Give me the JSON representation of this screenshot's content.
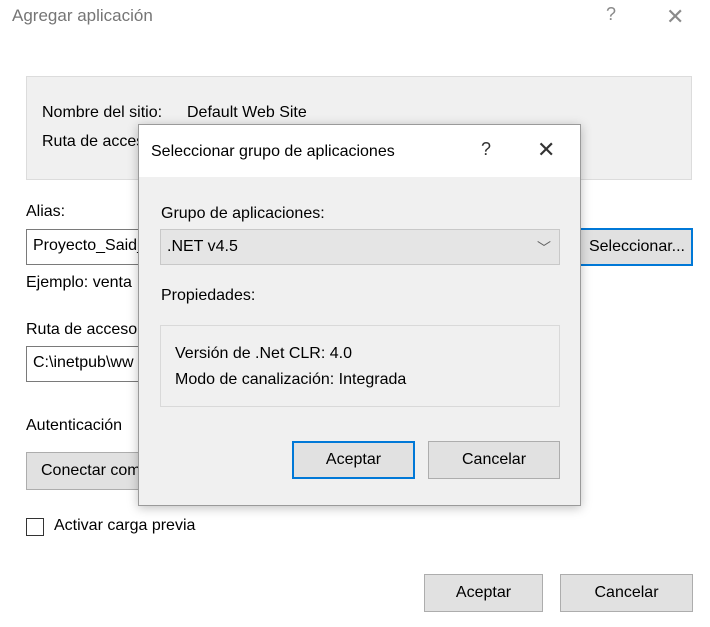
{
  "window": {
    "title": "Agregar aplicación",
    "help_glyph": "?",
    "close_glyph": "✕"
  },
  "site": {
    "name_label": "Nombre del sitio:",
    "name_value": "Default Web Site",
    "path_label": "Ruta de acces"
  },
  "alias": {
    "label": "Alias:",
    "value": "Proyecto_Said_",
    "select_button": "Seleccionar...",
    "example": "Ejemplo: venta"
  },
  "physical_path": {
    "label": "Ruta de acceso",
    "value": "C:\\inetpub\\ww"
  },
  "auth": {
    "label": "Autenticación",
    "connect_button": "Conectar com"
  },
  "preload": {
    "label": "Activar carga previa",
    "checked": false
  },
  "footer": {
    "ok_label": "Aceptar",
    "cancel_label": "Cancelar"
  },
  "dialog": {
    "title": "Seleccionar grupo de aplicaciones",
    "help_glyph": "?",
    "close_glyph": "✕",
    "pool_label": "Grupo de aplicaciones:",
    "pool_value": ".NET v4.5",
    "chevron_glyph": "﹀",
    "props_label": "Propiedades:",
    "clr_version": "Versión de .Net CLR: 4.0",
    "pipeline_mode": "Modo de canalización: Integrada",
    "ok_label": "Aceptar",
    "cancel_label": "Cancelar"
  },
  "colors": {
    "accent": "#0078d7",
    "panel_bg": "#f0f0f0",
    "button_bg": "#e1e1e1",
    "title_text": "#757575"
  }
}
